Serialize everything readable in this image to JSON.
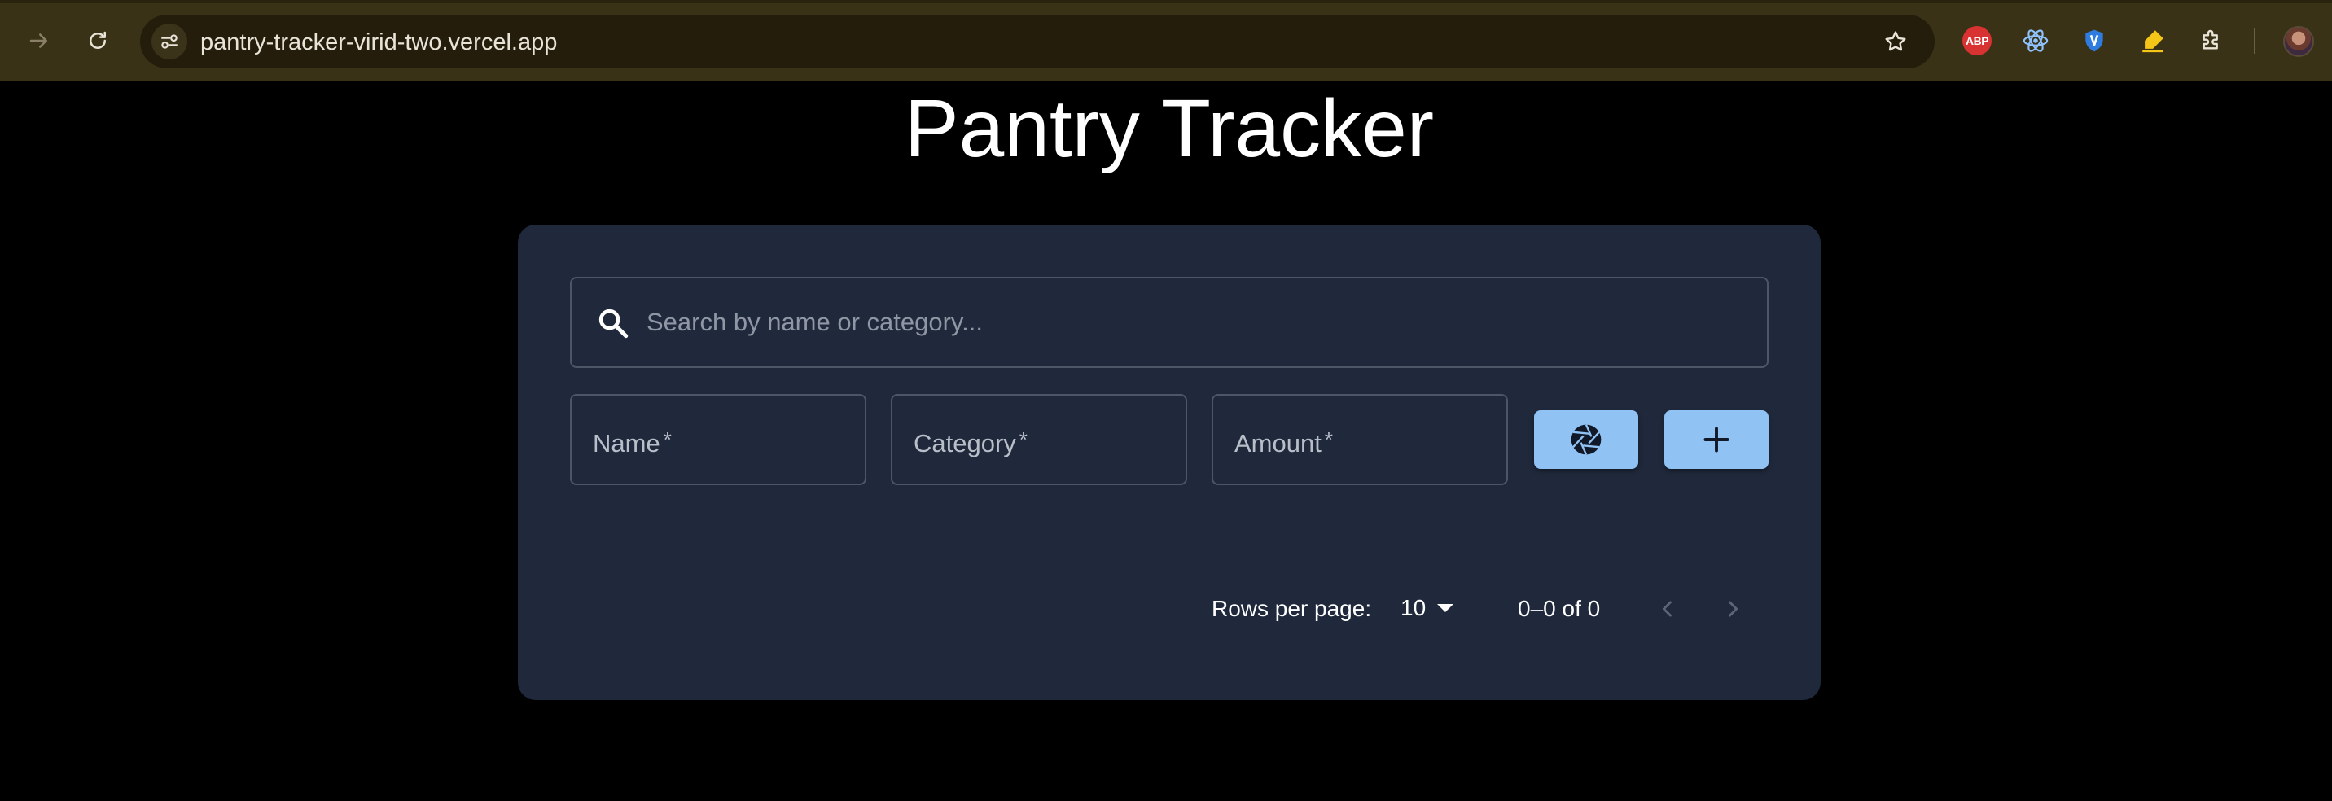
{
  "browser": {
    "url": "pantry-tracker-virid-two.vercel.app",
    "extensions": [
      {
        "name": "adblock-plus-icon",
        "label": "ABP"
      },
      {
        "name": "react-devtools-icon"
      },
      {
        "name": "vpn-shield-icon"
      },
      {
        "name": "highlighter-icon"
      },
      {
        "name": "extensions-puzzle-icon"
      }
    ]
  },
  "page": {
    "title": "Pantry Tracker"
  },
  "search": {
    "placeholder": "Search by name or category...",
    "icon": "search-icon"
  },
  "form": {
    "name_label": "Name",
    "category_label": "Category",
    "amount_label": "Amount",
    "required_marker": "*",
    "camera_icon": "camera-aperture-icon",
    "add_icon": "plus-icon"
  },
  "pagination": {
    "rows_per_page_label": "Rows per page:",
    "rows_per_page_value": "10",
    "range_text": "0–0 of 0"
  },
  "colors": {
    "page_background": "#000000",
    "card_background": "#1f293b",
    "button_background": "#90c2f4",
    "browser_chrome": "#3a3216"
  }
}
